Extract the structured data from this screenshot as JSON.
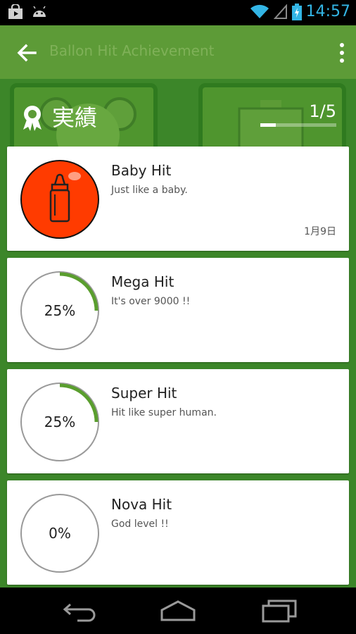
{
  "status_bar": {
    "time": "14:57",
    "icons": [
      "shop-bag-icon",
      "android-icon",
      "wifi-icon",
      "signal-icon",
      "battery-charging-icon"
    ]
  },
  "action_bar": {
    "title": "Ballon Hit Achievement",
    "back_icon": "arrow-left-icon",
    "overflow_icon": "more-vertical-icon"
  },
  "header": {
    "title": "実績",
    "progress_text": "1/5",
    "progress_value": 0.2,
    "icon": "ribbon-award-icon"
  },
  "achievements": [
    {
      "title": "Baby Hit",
      "description": "Just like a baby.",
      "date": "1月9日",
      "unlocked": true,
      "badge_icon": "baby-bottle-icon",
      "badge_color": "#ff3b00"
    },
    {
      "title": "Mega Hit",
      "description": "It's over 9000 !!",
      "percent_text": "25%",
      "percent": 25,
      "unlocked": false
    },
    {
      "title": "Super Hit",
      "description": "Hit like super human.",
      "percent_text": "25%",
      "percent": 25,
      "unlocked": false
    },
    {
      "title": "Nova Hit",
      "description": "God level !!",
      "percent_text": "0%",
      "percent": 0,
      "unlocked": false
    }
  ],
  "nav_bar": {
    "icons": [
      "back-nav-icon",
      "home-nav-icon",
      "recent-apps-icon"
    ]
  },
  "colors": {
    "accent_green": "#5a9e2e",
    "badge_red": "#ff3b00",
    "status_blue": "#33b5e5"
  }
}
